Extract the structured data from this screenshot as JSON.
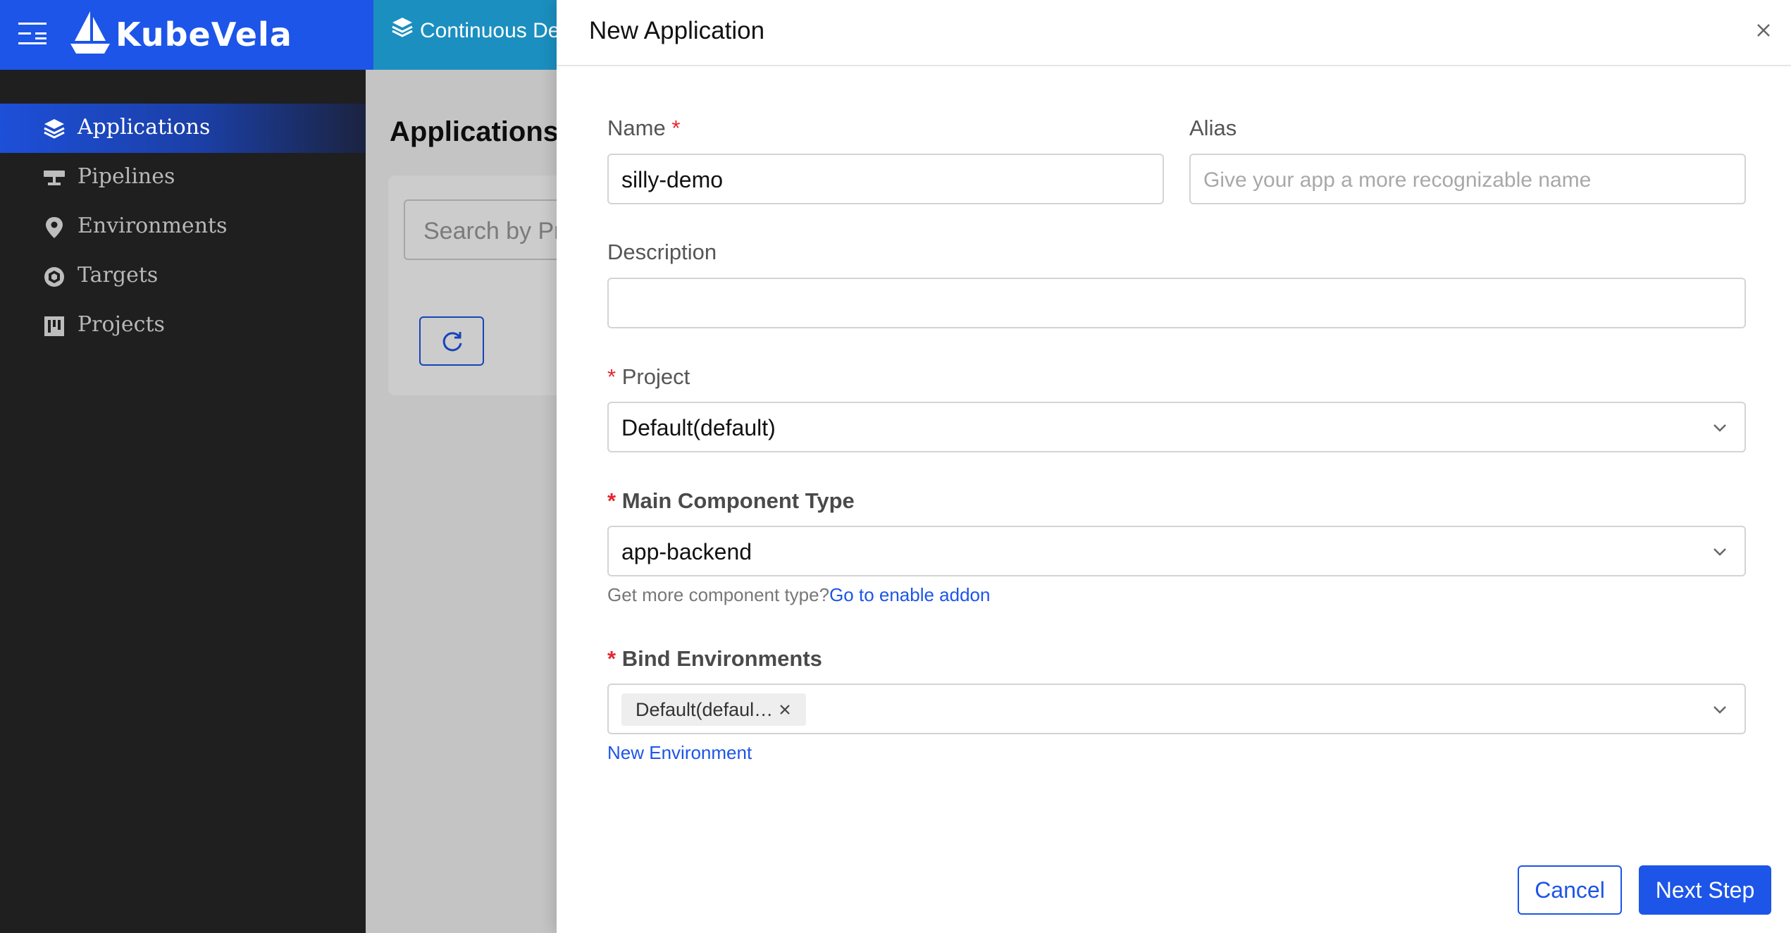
{
  "header": {
    "brand": "KubeVela",
    "tab_label": "Continuous Delivery"
  },
  "sidebar": {
    "items": [
      {
        "label": "Applications",
        "icon": "layers-icon",
        "active": true
      },
      {
        "label": "Pipelines",
        "icon": "pipeline-icon",
        "active": false
      },
      {
        "label": "Environments",
        "icon": "location-pin-icon",
        "active": false
      },
      {
        "label": "Targets",
        "icon": "target-icon",
        "active": false
      },
      {
        "label": "Projects",
        "icon": "board-icon",
        "active": false
      }
    ]
  },
  "main": {
    "title": "Applications",
    "search_placeholder": "Search by Project"
  },
  "drawer": {
    "title": "New Application",
    "name": {
      "label": "Name",
      "required_mark": "*",
      "value": "silly-demo"
    },
    "alias": {
      "label": "Alias",
      "placeholder": "Give your app a more recognizable name"
    },
    "description": {
      "label": "Description",
      "value": ""
    },
    "project": {
      "required_mark": "*",
      "label": "Project",
      "value": "Default(default)"
    },
    "component_type": {
      "required_mark": "*",
      "label": "Main Component Type",
      "value": "app-backend",
      "help_text": "Get more component type?",
      "help_link": "Go to enable addon"
    },
    "environments": {
      "required_mark": "*",
      "label": "Bind Environments",
      "tag": "Default(defaul…",
      "link": "New Environment"
    },
    "buttons": {
      "cancel": "Cancel",
      "next": "Next Step"
    }
  },
  "colors": {
    "primary": "#1d55e8",
    "tab": "#1b8fc0",
    "sidebar_bg": "#1f1f1f",
    "required": "#e6262e"
  }
}
